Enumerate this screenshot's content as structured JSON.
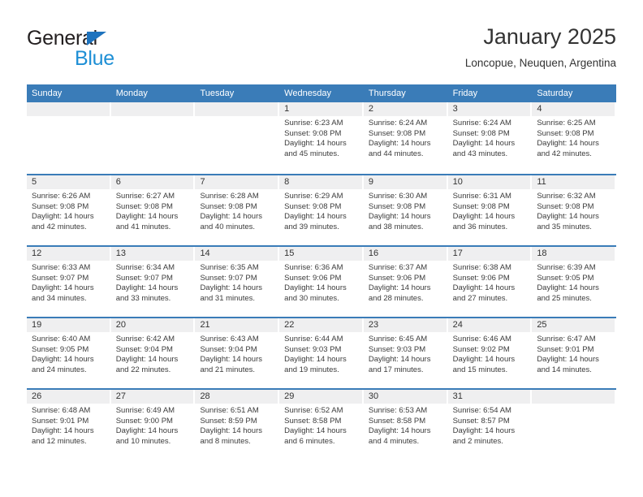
{
  "brand": {
    "name_top": "General",
    "name_bottom": "Blue",
    "triangle_color": "#1e73be",
    "blue_color": "#1e8fd5"
  },
  "header": {
    "title": "January 2025",
    "subtitle": "Loncopue, Neuquen, Argentina"
  },
  "theme": {
    "header_blue": "#3a7cb8",
    "day_band_gray": "#efeff0",
    "text_color": "#333333"
  },
  "calendar": {
    "weekday_headers": [
      "Sunday",
      "Monday",
      "Tuesday",
      "Wednesday",
      "Thursday",
      "Friday",
      "Saturday"
    ],
    "weeks": [
      [
        {
          "day": "",
          "lines": []
        },
        {
          "day": "",
          "lines": []
        },
        {
          "day": "",
          "lines": []
        },
        {
          "day": "1",
          "lines": [
            "Sunrise: 6:23 AM",
            "Sunset: 9:08 PM",
            "Daylight: 14 hours",
            "and 45 minutes."
          ]
        },
        {
          "day": "2",
          "lines": [
            "Sunrise: 6:24 AM",
            "Sunset: 9:08 PM",
            "Daylight: 14 hours",
            "and 44 minutes."
          ]
        },
        {
          "day": "3",
          "lines": [
            "Sunrise: 6:24 AM",
            "Sunset: 9:08 PM",
            "Daylight: 14 hours",
            "and 43 minutes."
          ]
        },
        {
          "day": "4",
          "lines": [
            "Sunrise: 6:25 AM",
            "Sunset: 9:08 PM",
            "Daylight: 14 hours",
            "and 42 minutes."
          ]
        }
      ],
      [
        {
          "day": "5",
          "lines": [
            "Sunrise: 6:26 AM",
            "Sunset: 9:08 PM",
            "Daylight: 14 hours",
            "and 42 minutes."
          ]
        },
        {
          "day": "6",
          "lines": [
            "Sunrise: 6:27 AM",
            "Sunset: 9:08 PM",
            "Daylight: 14 hours",
            "and 41 minutes."
          ]
        },
        {
          "day": "7",
          "lines": [
            "Sunrise: 6:28 AM",
            "Sunset: 9:08 PM",
            "Daylight: 14 hours",
            "and 40 minutes."
          ]
        },
        {
          "day": "8",
          "lines": [
            "Sunrise: 6:29 AM",
            "Sunset: 9:08 PM",
            "Daylight: 14 hours",
            "and 39 minutes."
          ]
        },
        {
          "day": "9",
          "lines": [
            "Sunrise: 6:30 AM",
            "Sunset: 9:08 PM",
            "Daylight: 14 hours",
            "and 38 minutes."
          ]
        },
        {
          "day": "10",
          "lines": [
            "Sunrise: 6:31 AM",
            "Sunset: 9:08 PM",
            "Daylight: 14 hours",
            "and 36 minutes."
          ]
        },
        {
          "day": "11",
          "lines": [
            "Sunrise: 6:32 AM",
            "Sunset: 9:08 PM",
            "Daylight: 14 hours",
            "and 35 minutes."
          ]
        }
      ],
      [
        {
          "day": "12",
          "lines": [
            "Sunrise: 6:33 AM",
            "Sunset: 9:07 PM",
            "Daylight: 14 hours",
            "and 34 minutes."
          ]
        },
        {
          "day": "13",
          "lines": [
            "Sunrise: 6:34 AM",
            "Sunset: 9:07 PM",
            "Daylight: 14 hours",
            "and 33 minutes."
          ]
        },
        {
          "day": "14",
          "lines": [
            "Sunrise: 6:35 AM",
            "Sunset: 9:07 PM",
            "Daylight: 14 hours",
            "and 31 minutes."
          ]
        },
        {
          "day": "15",
          "lines": [
            "Sunrise: 6:36 AM",
            "Sunset: 9:06 PM",
            "Daylight: 14 hours",
            "and 30 minutes."
          ]
        },
        {
          "day": "16",
          "lines": [
            "Sunrise: 6:37 AM",
            "Sunset: 9:06 PM",
            "Daylight: 14 hours",
            "and 28 minutes."
          ]
        },
        {
          "day": "17",
          "lines": [
            "Sunrise: 6:38 AM",
            "Sunset: 9:06 PM",
            "Daylight: 14 hours",
            "and 27 minutes."
          ]
        },
        {
          "day": "18",
          "lines": [
            "Sunrise: 6:39 AM",
            "Sunset: 9:05 PM",
            "Daylight: 14 hours",
            "and 25 minutes."
          ]
        }
      ],
      [
        {
          "day": "19",
          "lines": [
            "Sunrise: 6:40 AM",
            "Sunset: 9:05 PM",
            "Daylight: 14 hours",
            "and 24 minutes."
          ]
        },
        {
          "day": "20",
          "lines": [
            "Sunrise: 6:42 AM",
            "Sunset: 9:04 PM",
            "Daylight: 14 hours",
            "and 22 minutes."
          ]
        },
        {
          "day": "21",
          "lines": [
            "Sunrise: 6:43 AM",
            "Sunset: 9:04 PM",
            "Daylight: 14 hours",
            "and 21 minutes."
          ]
        },
        {
          "day": "22",
          "lines": [
            "Sunrise: 6:44 AM",
            "Sunset: 9:03 PM",
            "Daylight: 14 hours",
            "and 19 minutes."
          ]
        },
        {
          "day": "23",
          "lines": [
            "Sunrise: 6:45 AM",
            "Sunset: 9:03 PM",
            "Daylight: 14 hours",
            "and 17 minutes."
          ]
        },
        {
          "day": "24",
          "lines": [
            "Sunrise: 6:46 AM",
            "Sunset: 9:02 PM",
            "Daylight: 14 hours",
            "and 15 minutes."
          ]
        },
        {
          "day": "25",
          "lines": [
            "Sunrise: 6:47 AM",
            "Sunset: 9:01 PM",
            "Daylight: 14 hours",
            "and 14 minutes."
          ]
        }
      ],
      [
        {
          "day": "26",
          "lines": [
            "Sunrise: 6:48 AM",
            "Sunset: 9:01 PM",
            "Daylight: 14 hours",
            "and 12 minutes."
          ]
        },
        {
          "day": "27",
          "lines": [
            "Sunrise: 6:49 AM",
            "Sunset: 9:00 PM",
            "Daylight: 14 hours",
            "and 10 minutes."
          ]
        },
        {
          "day": "28",
          "lines": [
            "Sunrise: 6:51 AM",
            "Sunset: 8:59 PM",
            "Daylight: 14 hours",
            "and 8 minutes."
          ]
        },
        {
          "day": "29",
          "lines": [
            "Sunrise: 6:52 AM",
            "Sunset: 8:58 PM",
            "Daylight: 14 hours",
            "and 6 minutes."
          ]
        },
        {
          "day": "30",
          "lines": [
            "Sunrise: 6:53 AM",
            "Sunset: 8:58 PM",
            "Daylight: 14 hours",
            "and 4 minutes."
          ]
        },
        {
          "day": "31",
          "lines": [
            "Sunrise: 6:54 AM",
            "Sunset: 8:57 PM",
            "Daylight: 14 hours",
            "and 2 minutes."
          ]
        },
        {
          "day": "",
          "lines": []
        }
      ]
    ]
  }
}
